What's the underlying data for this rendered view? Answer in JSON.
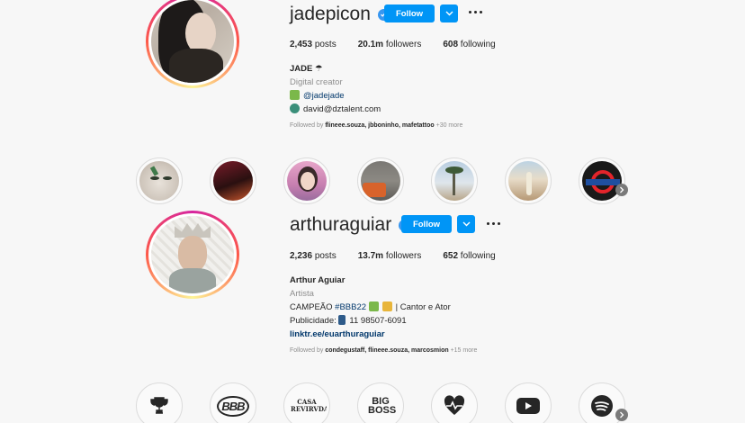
{
  "profiles": [
    {
      "username": "jadepicon",
      "follow_label": "Follow",
      "posts": "2,453",
      "posts_label": "posts",
      "followers": "20.1m",
      "followers_label": "followers",
      "following": "608",
      "following_label": "following",
      "name": "JADE",
      "category": "Digital creator",
      "bio_lines": [
        "@jadejade",
        "david@dztalent.com"
      ],
      "followed_prefix": "Followed by",
      "followed_names": "flineee.souza, jbboninho, mafetattoo",
      "followed_more": "+30 more"
    },
    {
      "username": "arthuraguiar",
      "follow_label": "Follow",
      "posts": "2,236",
      "posts_label": "posts",
      "followers": "13.7m",
      "followers_label": "followers",
      "following": "652",
      "following_label": "following",
      "name": "Arthur Aguiar",
      "category": "Artista",
      "bio_line1_pre": "CAMPEÃO",
      "bio_line1_tag": "#BBB22",
      "bio_line1_post": "| Cantor e Ator",
      "bio_line2_pre": "Publicidade:",
      "bio_line2_post": "11 98507-6091",
      "link": "linktr.ee/euarthuraguiar",
      "followed_prefix": "Followed by",
      "followed_names": "condegustaff, flineee.souza, marcosmion",
      "followed_more": "+15 more"
    }
  ],
  "highlights_icon_labels": [
    "CASA REVIRVDA",
    "BIG BOSS",
    "BBB"
  ],
  "colors": {
    "accent": "#0095f6",
    "verified": "#3897f0",
    "link": "#00376b"
  }
}
